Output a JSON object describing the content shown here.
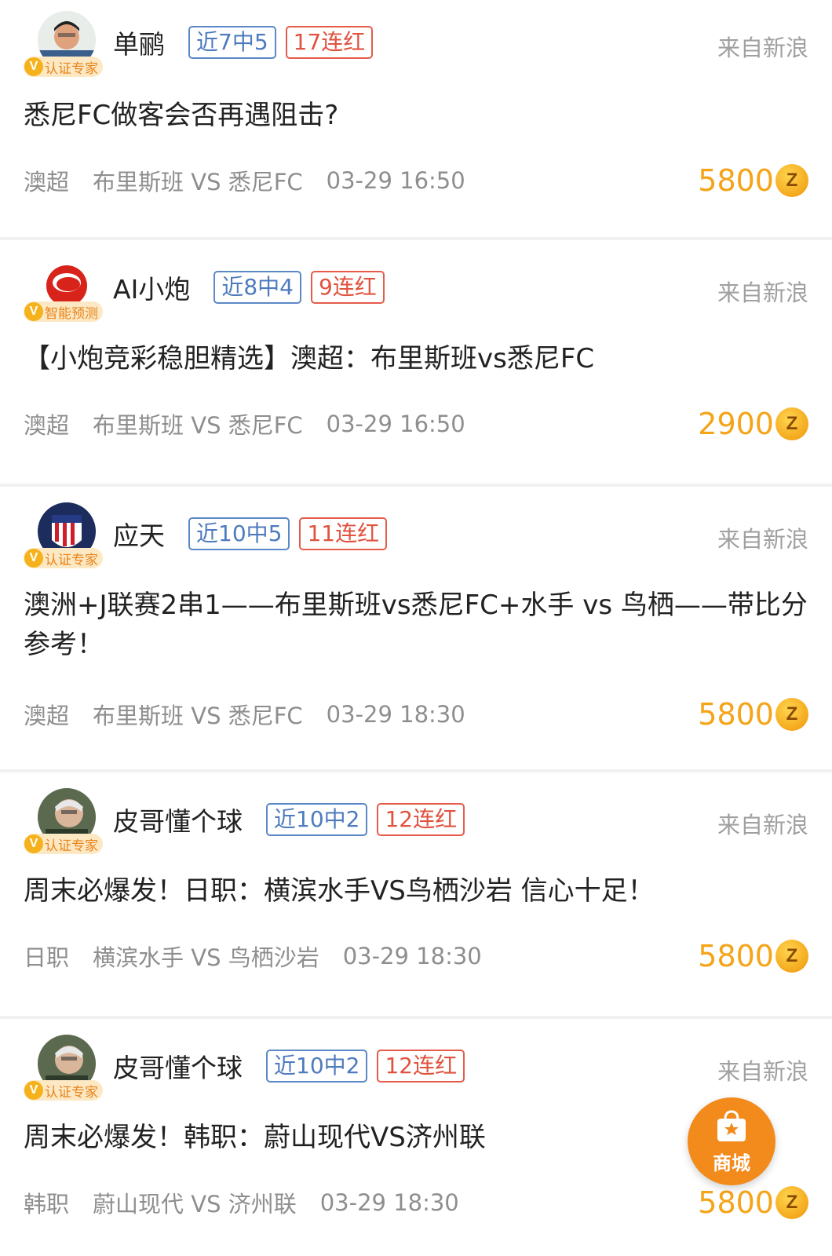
{
  "posts": [
    {
      "author": "单鹂",
      "badge": "认证专家",
      "tag_hit": "近7中5",
      "tag_streak": "17连红",
      "source": "来自新浪",
      "title": "悉尼FC做客会否再遇阻击?",
      "league": "澳超",
      "match": "布里斯班 VS 悉尼FC",
      "time": "03-29 16:50",
      "price": "5800"
    },
    {
      "author": "AI小炮",
      "badge": "智能预测",
      "tag_hit": "近8中4",
      "tag_streak": "9连红",
      "source": "来自新浪",
      "title": "【小炮竞彩稳胆精选】澳超：布里斯班vs悉尼FC",
      "league": "澳超",
      "match": "布里斯班 VS 悉尼FC",
      "time": "03-29 16:50",
      "price": "2900"
    },
    {
      "author": "应天",
      "badge": "认证专家",
      "tag_hit": "近10中5",
      "tag_streak": "11连红",
      "source": "来自新浪",
      "title": "澳洲+J联赛2串1——布里斯班vs悉尼FC+水手 vs 鸟栖——带比分参考！",
      "league": "澳超",
      "match": "布里斯班 VS 悉尼FC",
      "time": "03-29 18:30",
      "price": "5800"
    },
    {
      "author": "皮哥懂个球",
      "badge": "认证专家",
      "tag_hit": "近10中2",
      "tag_streak": "12连红",
      "source": "来自新浪",
      "title": "周末必爆发！日职：横滨水手VS鸟栖沙岩 信心十足！",
      "league": "日职",
      "match": "横滨水手 VS 鸟栖沙岩",
      "time": "03-29 18:30",
      "price": "5800"
    },
    {
      "author": "皮哥懂个球",
      "badge": "认证专家",
      "tag_hit": "近10中2",
      "tag_streak": "12连红",
      "source": "来自新浪",
      "title": "周末必爆发！韩职：蔚山现代VS济州联",
      "league": "韩职",
      "match": "蔚山现代 VS 济州联",
      "time": "03-29 18:30",
      "price": "5800"
    }
  ],
  "fab": {
    "label": "商城",
    "icon": "shopping-bag-star-icon"
  },
  "colors": {
    "price": "#f5a418",
    "tag_blue": "#4e7bbd",
    "tag_red": "#e0533f",
    "fab": "#f28a1c"
  }
}
